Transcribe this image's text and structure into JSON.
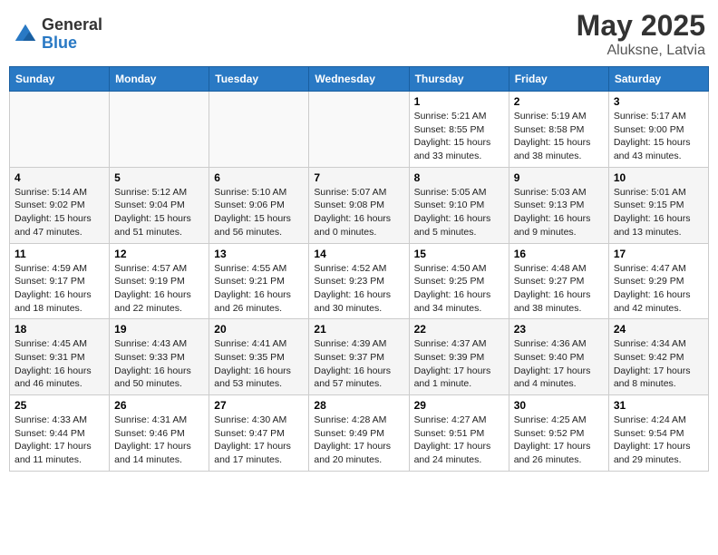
{
  "header": {
    "logo_general": "General",
    "logo_blue": "Blue",
    "month": "May 2025",
    "location": "Aluksne, Latvia"
  },
  "weekdays": [
    "Sunday",
    "Monday",
    "Tuesday",
    "Wednesday",
    "Thursday",
    "Friday",
    "Saturday"
  ],
  "weeks": [
    [
      {
        "day": "",
        "info": ""
      },
      {
        "day": "",
        "info": ""
      },
      {
        "day": "",
        "info": ""
      },
      {
        "day": "",
        "info": ""
      },
      {
        "day": "1",
        "info": "Sunrise: 5:21 AM\nSunset: 8:55 PM\nDaylight: 15 hours\nand 33 minutes."
      },
      {
        "day": "2",
        "info": "Sunrise: 5:19 AM\nSunset: 8:58 PM\nDaylight: 15 hours\nand 38 minutes."
      },
      {
        "day": "3",
        "info": "Sunrise: 5:17 AM\nSunset: 9:00 PM\nDaylight: 15 hours\nand 43 minutes."
      }
    ],
    [
      {
        "day": "4",
        "info": "Sunrise: 5:14 AM\nSunset: 9:02 PM\nDaylight: 15 hours\nand 47 minutes."
      },
      {
        "day": "5",
        "info": "Sunrise: 5:12 AM\nSunset: 9:04 PM\nDaylight: 15 hours\nand 51 minutes."
      },
      {
        "day": "6",
        "info": "Sunrise: 5:10 AM\nSunset: 9:06 PM\nDaylight: 15 hours\nand 56 minutes."
      },
      {
        "day": "7",
        "info": "Sunrise: 5:07 AM\nSunset: 9:08 PM\nDaylight: 16 hours\nand 0 minutes."
      },
      {
        "day": "8",
        "info": "Sunrise: 5:05 AM\nSunset: 9:10 PM\nDaylight: 16 hours\nand 5 minutes."
      },
      {
        "day": "9",
        "info": "Sunrise: 5:03 AM\nSunset: 9:13 PM\nDaylight: 16 hours\nand 9 minutes."
      },
      {
        "day": "10",
        "info": "Sunrise: 5:01 AM\nSunset: 9:15 PM\nDaylight: 16 hours\nand 13 minutes."
      }
    ],
    [
      {
        "day": "11",
        "info": "Sunrise: 4:59 AM\nSunset: 9:17 PM\nDaylight: 16 hours\nand 18 minutes."
      },
      {
        "day": "12",
        "info": "Sunrise: 4:57 AM\nSunset: 9:19 PM\nDaylight: 16 hours\nand 22 minutes."
      },
      {
        "day": "13",
        "info": "Sunrise: 4:55 AM\nSunset: 9:21 PM\nDaylight: 16 hours\nand 26 minutes."
      },
      {
        "day": "14",
        "info": "Sunrise: 4:52 AM\nSunset: 9:23 PM\nDaylight: 16 hours\nand 30 minutes."
      },
      {
        "day": "15",
        "info": "Sunrise: 4:50 AM\nSunset: 9:25 PM\nDaylight: 16 hours\nand 34 minutes."
      },
      {
        "day": "16",
        "info": "Sunrise: 4:48 AM\nSunset: 9:27 PM\nDaylight: 16 hours\nand 38 minutes."
      },
      {
        "day": "17",
        "info": "Sunrise: 4:47 AM\nSunset: 9:29 PM\nDaylight: 16 hours\nand 42 minutes."
      }
    ],
    [
      {
        "day": "18",
        "info": "Sunrise: 4:45 AM\nSunset: 9:31 PM\nDaylight: 16 hours\nand 46 minutes."
      },
      {
        "day": "19",
        "info": "Sunrise: 4:43 AM\nSunset: 9:33 PM\nDaylight: 16 hours\nand 50 minutes."
      },
      {
        "day": "20",
        "info": "Sunrise: 4:41 AM\nSunset: 9:35 PM\nDaylight: 16 hours\nand 53 minutes."
      },
      {
        "day": "21",
        "info": "Sunrise: 4:39 AM\nSunset: 9:37 PM\nDaylight: 16 hours\nand 57 minutes."
      },
      {
        "day": "22",
        "info": "Sunrise: 4:37 AM\nSunset: 9:39 PM\nDaylight: 17 hours\nand 1 minute."
      },
      {
        "day": "23",
        "info": "Sunrise: 4:36 AM\nSunset: 9:40 PM\nDaylight: 17 hours\nand 4 minutes."
      },
      {
        "day": "24",
        "info": "Sunrise: 4:34 AM\nSunset: 9:42 PM\nDaylight: 17 hours\nand 8 minutes."
      }
    ],
    [
      {
        "day": "25",
        "info": "Sunrise: 4:33 AM\nSunset: 9:44 PM\nDaylight: 17 hours\nand 11 minutes."
      },
      {
        "day": "26",
        "info": "Sunrise: 4:31 AM\nSunset: 9:46 PM\nDaylight: 17 hours\nand 14 minutes."
      },
      {
        "day": "27",
        "info": "Sunrise: 4:30 AM\nSunset: 9:47 PM\nDaylight: 17 hours\nand 17 minutes."
      },
      {
        "day": "28",
        "info": "Sunrise: 4:28 AM\nSunset: 9:49 PM\nDaylight: 17 hours\nand 20 minutes."
      },
      {
        "day": "29",
        "info": "Sunrise: 4:27 AM\nSunset: 9:51 PM\nDaylight: 17 hours\nand 24 minutes."
      },
      {
        "day": "30",
        "info": "Sunrise: 4:25 AM\nSunset: 9:52 PM\nDaylight: 17 hours\nand 26 minutes."
      },
      {
        "day": "31",
        "info": "Sunrise: 4:24 AM\nSunset: 9:54 PM\nDaylight: 17 hours\nand 29 minutes."
      }
    ]
  ]
}
